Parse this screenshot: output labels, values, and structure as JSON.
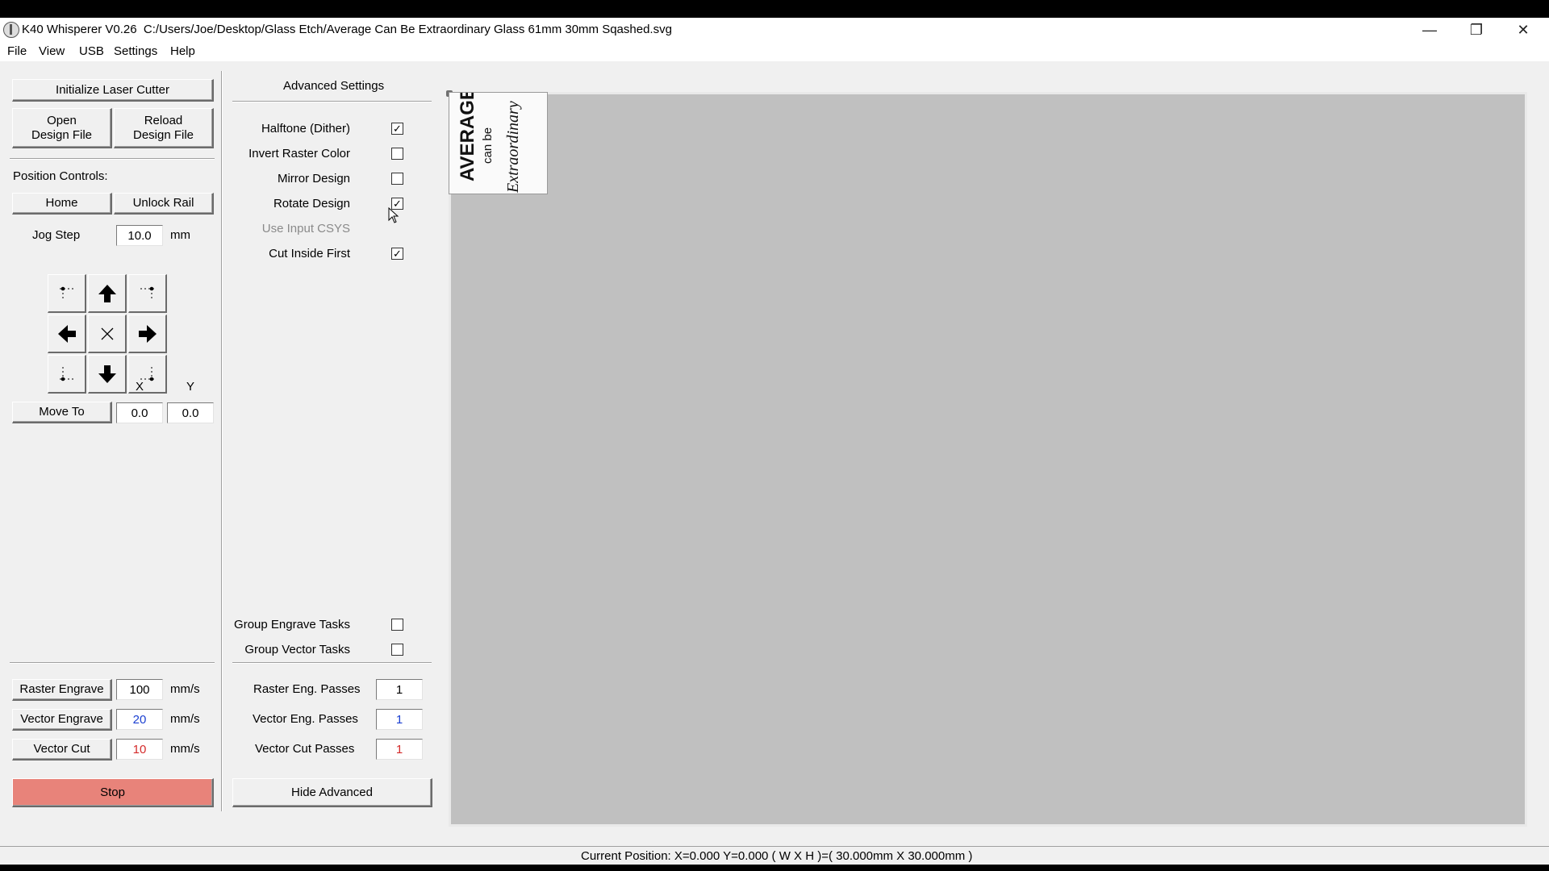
{
  "window": {
    "title": "K40 Whisperer V0.26",
    "path": "C:/Users/Joe/Desktop/Glass Etch/Average Can Be Extraordinary Glass 61mm 30mm Sqashed.svg",
    "buttons": {
      "minimize": "—",
      "maximize": "❐",
      "close": "✕"
    }
  },
  "menu": [
    "File",
    "View",
    "USB",
    "Settings",
    "Help"
  ],
  "left": {
    "init_label": "Initialize Laser Cutter",
    "open_label_1": "Open",
    "open_label_2": "Design File",
    "reload_label_1": "Reload",
    "reload_label_2": "Design File",
    "position_controls": "Position Controls:",
    "home_label": "Home",
    "unlock_label": "Unlock Rail",
    "jog_step_label": "Jog Step",
    "jog_step_value": "10.0",
    "jog_step_unit": "mm",
    "x_label": "X",
    "y_label": "Y",
    "move_to_label": "Move To",
    "move_x": "0.0",
    "move_y": "0.0",
    "raster_label": "Raster Engrave",
    "raster_speed": "100",
    "vector_engrave_label": "Vector Engrave",
    "vector_engrave_speed": "20",
    "vector_cut_label": "Vector Cut",
    "vector_cut_speed": "10",
    "speed_unit": "mm/s",
    "stop_label": "Stop"
  },
  "advanced": {
    "title": "Advanced Settings",
    "options": [
      {
        "label": "Halftone (Dither)",
        "checked": true,
        "enabled": true
      },
      {
        "label": "Invert Raster Color",
        "checked": false,
        "enabled": true
      },
      {
        "label": "Mirror Design",
        "checked": false,
        "enabled": true
      },
      {
        "label": "Rotate Design",
        "checked": true,
        "enabled": true
      },
      {
        "label": "Use Input CSYS",
        "checked": false,
        "enabled": false
      },
      {
        "label": "Cut Inside First",
        "checked": true,
        "enabled": true
      }
    ],
    "group_engrave_label": "Group Engrave Tasks",
    "group_vector_label": "Group Vector Tasks",
    "raster_passes_label": "Raster Eng. Passes",
    "raster_passes": "1",
    "vector_passes_label": "Vector Eng. Passes",
    "vector_passes": "1",
    "cut_passes_label": "Vector Cut Passes",
    "cut_passes": "1",
    "hide_label": "Hide Advanced"
  },
  "design": {
    "line1": "AVERAGE",
    "line2": "can be",
    "line3": "Extraordinary"
  },
  "status": "Current Position: X=0.000 Y=0.000    ( W X H )=( 30.000mm X 30.000mm )",
  "colors": {
    "stop": "#e8837a",
    "vector_engrave_text": "#1a3fd1",
    "vector_cut_text": "#d42a2a",
    "canvas": "#c0c0c0"
  }
}
